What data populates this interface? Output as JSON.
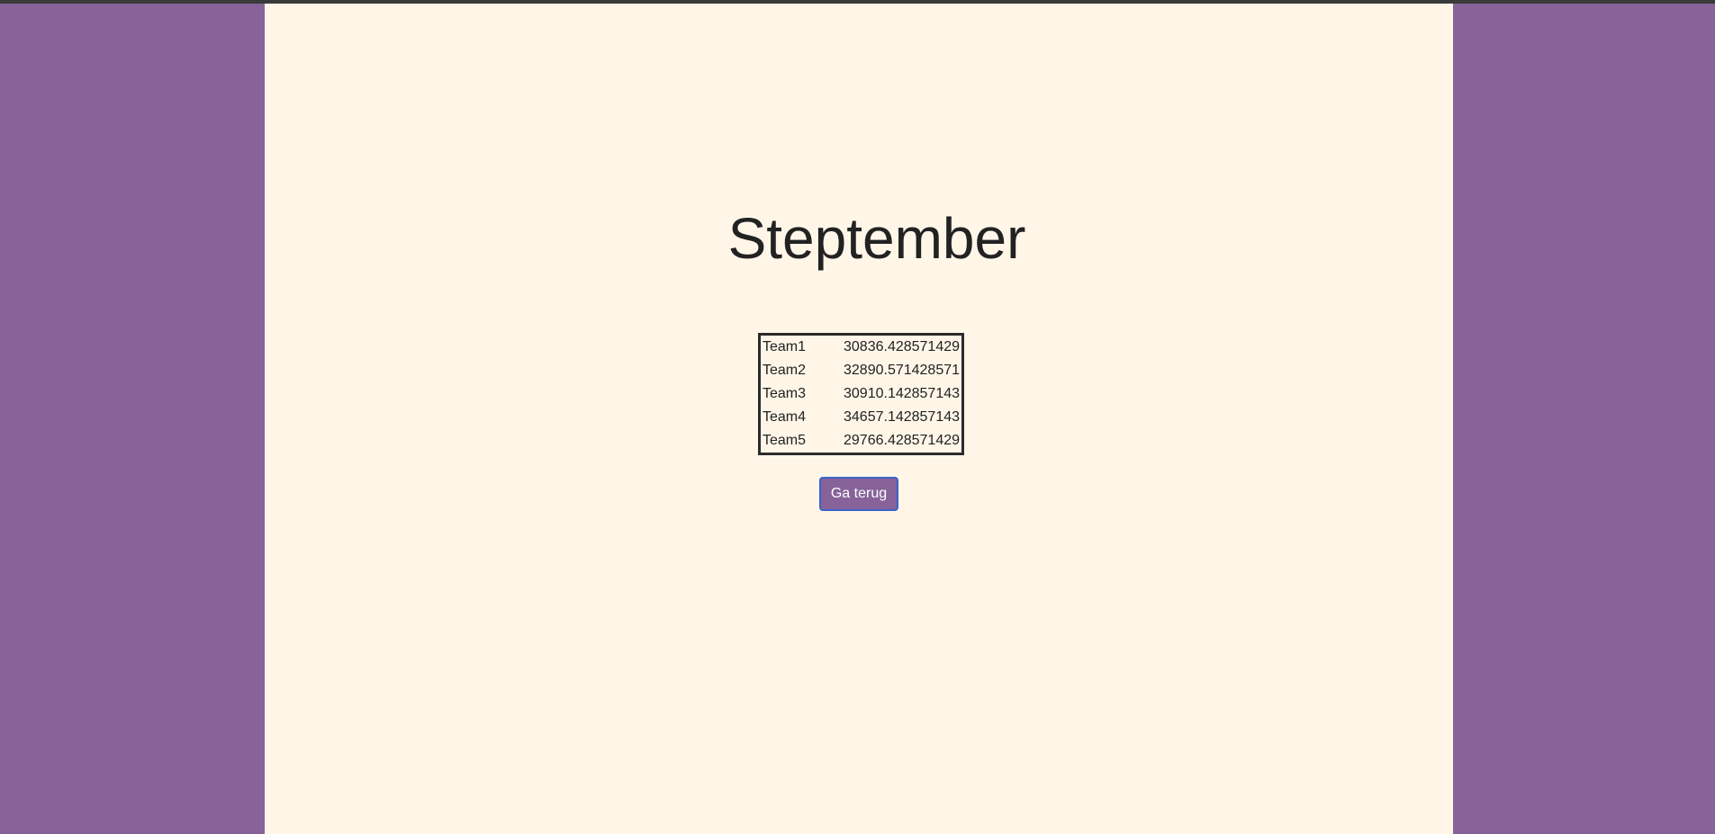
{
  "page": {
    "title": "Steptember"
  },
  "table": {
    "rows": [
      {
        "team": "Team1",
        "value": "30836.428571429"
      },
      {
        "team": "Team2",
        "value": "32890.571428571"
      },
      {
        "team": "Team3",
        "value": "30910.142857143"
      },
      {
        "team": "Team4",
        "value": "34657.142857143"
      },
      {
        "team": "Team5",
        "value": "29766.428571429"
      }
    ]
  },
  "actions": {
    "back_label": "Ga terug"
  },
  "colors": {
    "background": "#87639a",
    "content": "#fff6e8",
    "button": "#87639a",
    "button_border": "#3b63c7"
  }
}
